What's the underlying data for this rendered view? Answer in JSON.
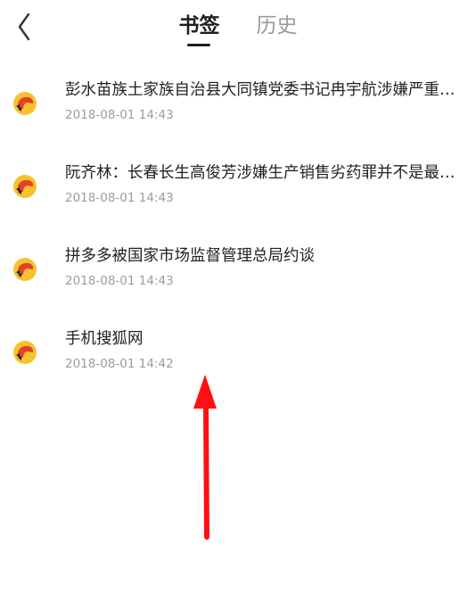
{
  "header": {
    "back_icon": "chevron-left-icon",
    "tabs": [
      {
        "label": "书签",
        "active": true
      },
      {
        "label": "历史",
        "active": false
      }
    ]
  },
  "bookmarks": [
    {
      "title": "彭水苗族土家族自治县大同镇党委书记冉宇航涉嫌严重违纪",
      "time": "2018-08-01 14:43",
      "icon": "sohu-fox-icon"
    },
    {
      "title": "阮齐林：长春长生高俊芳涉嫌生产销售劣药罪并不是最终定性",
      "time": "2018-08-01 14:43",
      "icon": "sohu-fox-icon"
    },
    {
      "title": "拼多多被国家市场监督管理总局约谈",
      "time": "2018-08-01 14:43",
      "icon": "sohu-fox-icon"
    },
    {
      "title": "手机搜狐网",
      "time": "2018-08-01 14:42",
      "icon": "sohu-fox-icon"
    }
  ],
  "colors": {
    "favicon_yellow": "#f6c32d",
    "favicon_red": "#e5402a",
    "annotation_arrow": "#ff1010"
  }
}
